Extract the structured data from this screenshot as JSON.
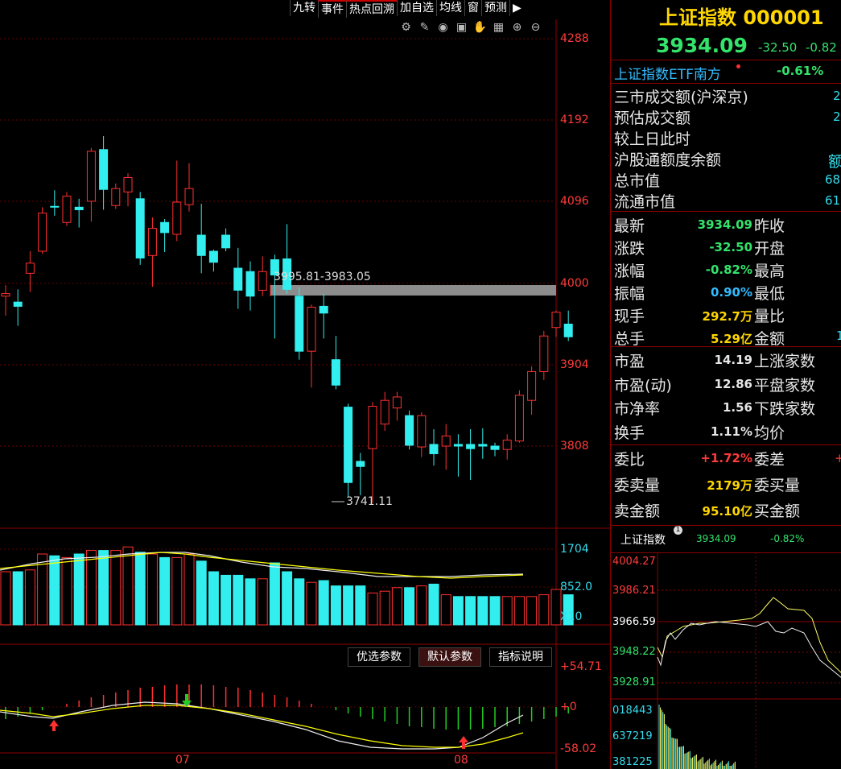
{
  "toolbar": {
    "items": [
      "九转",
      "事件",
      "热点回溯",
      "加自选",
      "均线",
      "窗",
      "预测"
    ]
  },
  "chart": {
    "price_axis": [
      "4288",
      "4192",
      "4096",
      "4000",
      "3904",
      "3808"
    ],
    "range_label": "3995.81-3983.05",
    "low_label": "3741.11",
    "vol_axis": [
      "1704",
      "852.0",
      "X10"
    ],
    "ind_axis": [
      "+54.71",
      "+0",
      "-58.02"
    ],
    "months": [
      "07",
      "08"
    ],
    "indicator_tabs": [
      "优选参数",
      "默认参数",
      "指标说明"
    ]
  },
  "panel": {
    "title": "上证指数 000001",
    "price": "3934.09",
    "change": "-32.50",
    "change_pct": "-0.82",
    "etf": {
      "name": "上证指数ETF南方",
      "pct": "-0.61%"
    },
    "info": [
      {
        "label": "三市成交额(沪深京)",
        "value": "2"
      },
      {
        "label": "预估成交额",
        "value": "2"
      },
      {
        "label": "较上日此时",
        "value": ""
      },
      {
        "label": "沪股通额度余额",
        "value": "额"
      },
      {
        "label": "总市值",
        "value": "68"
      },
      {
        "label": "流通市值",
        "value": "61"
      }
    ],
    "quote": [
      {
        "l": "最新",
        "v": "3934.09",
        "c": "#33e36b",
        "r": "昨收"
      },
      {
        "l": "涨跌",
        "v": "-32.50",
        "c": "#33e36b",
        "r": "开盘"
      },
      {
        "l": "涨幅",
        "v": "-0.82%",
        "c": "#33e36b",
        "r": "最高"
      },
      {
        "l": "振幅",
        "v": "0.90%",
        "c": "#33bbff",
        "r": "最低"
      },
      {
        "l": "现手",
        "v": "292.7万",
        "c": "#ffd700",
        "r": "量比"
      },
      {
        "l": "总手",
        "v": "5.29亿",
        "c": "#ffd700",
        "r": "金额"
      }
    ],
    "quote_extra": "1",
    "valuation": [
      {
        "l": "市盈",
        "v": "14.19",
        "r": "上涨家数"
      },
      {
        "l": "市盈(动)",
        "v": "12.86",
        "r": "平盘家数"
      },
      {
        "l": "市净率",
        "v": "1.56",
        "r": "下跌家数"
      },
      {
        "l": "换手",
        "v": "1.11%",
        "r": "均价"
      }
    ],
    "order": [
      {
        "l": "委比",
        "v": "+1.72%",
        "c": "#ff3b3b",
        "r": "委差",
        "x": "+"
      },
      {
        "l": "委卖量",
        "v": "2179万",
        "c": "#ffd700",
        "r": "委买量",
        "x": ""
      },
      {
        "l": "卖金额",
        "v": "95.10亿",
        "c": "#ffd700",
        "r": "买金额",
        "x": ""
      }
    ],
    "mini": {
      "name": "上证指数",
      "price": "3934.09",
      "pct": "-0.82%",
      "axis": [
        "4004.27",
        "3986.21",
        "3966.59",
        "3948.22",
        "3928.91",
        "018443",
        "637219",
        "381225"
      ]
    }
  },
  "chart_data": {
    "type": "candlestick",
    "candles": [
      {
        "o": 3985,
        "c": 3988,
        "h": 3998,
        "l": 3962
      },
      {
        "o": 3978,
        "c": 3973,
        "h": 3993,
        "l": 3950
      },
      {
        "o": 4012,
        "c": 4024,
        "h": 4038,
        "l": 3990
      },
      {
        "o": 4038,
        "c": 4083,
        "h": 4090,
        "l": 4035
      },
      {
        "o": 4091,
        "c": 4090,
        "h": 4110,
        "l": 4080
      },
      {
        "o": 4072,
        "c": 4103,
        "h": 4108,
        "l": 4068
      },
      {
        "o": 4090,
        "c": 4087,
        "h": 4100,
        "l": 4066
      },
      {
        "o": 4097,
        "c": 4156,
        "h": 4160,
        "l": 4073
      },
      {
        "o": 4158,
        "c": 4111,
        "h": 4174,
        "l": 4087
      },
      {
        "o": 4092,
        "c": 4112,
        "h": 4118,
        "l": 4088
      },
      {
        "o": 4108,
        "c": 4125,
        "h": 4130,
        "l": 4091
      },
      {
        "o": 4100,
        "c": 4030,
        "h": 4108,
        "l": 4022
      },
      {
        "o": 4033,
        "c": 4065,
        "h": 4078,
        "l": 3996
      },
      {
        "o": 4072,
        "c": 4060,
        "h": 4076,
        "l": 4037
      },
      {
        "o": 4058,
        "c": 4096,
        "h": 4145,
        "l": 4050
      },
      {
        "o": 4093,
        "c": 4112,
        "h": 4142,
        "l": 4085
      },
      {
        "o": 4057,
        "c": 4033,
        "h": 4094,
        "l": 4012
      },
      {
        "o": 4038,
        "c": 4025,
        "h": 4040,
        "l": 4014
      },
      {
        "o": 4057,
        "c": 4042,
        "h": 4065,
        "l": 4038
      },
      {
        "o": 4018,
        "c": 3992,
        "h": 4042,
        "l": 3970
      },
      {
        "o": 4014,
        "c": 3985,
        "h": 4026,
        "l": 3968
      },
      {
        "o": 3992,
        "c": 4014,
        "h": 4032,
        "l": 3985
      },
      {
        "o": 4028,
        "c": 4010,
        "h": 4034,
        "l": 3935
      },
      {
        "o": 4029,
        "c": 3993,
        "h": 4070,
        "l": 3988
      },
      {
        "o": 3985,
        "c": 3920,
        "h": 3995,
        "l": 3910
      },
      {
        "o": 3920,
        "c": 3972,
        "h": 3975,
        "l": 3877
      },
      {
        "o": 3973,
        "c": 3965,
        "h": 3988,
        "l": 3935
      },
      {
        "o": 3910,
        "c": 3880,
        "h": 3938,
        "l": 3875
      },
      {
        "o": 3854,
        "c": 3765,
        "h": 3858,
        "l": 3748
      },
      {
        "o": 3790,
        "c": 3784,
        "h": 3800,
        "l": 3750
      },
      {
        "o": 3805,
        "c": 3855,
        "h": 3860,
        "l": 3741
      },
      {
        "o": 3834,
        "c": 3862,
        "h": 3872,
        "l": 3826
      },
      {
        "o": 3853,
        "c": 3866,
        "h": 3872,
        "l": 3838
      },
      {
        "o": 3844,
        "c": 3809,
        "h": 3850,
        "l": 3804
      },
      {
        "o": 3807,
        "c": 3844,
        "h": 3848,
        "l": 3795
      },
      {
        "o": 3810,
        "c": 3799,
        "h": 3828,
        "l": 3785
      },
      {
        "o": 3808,
        "c": 3820,
        "h": 3834,
        "l": 3780
      },
      {
        "o": 3810,
        "c": 3808,
        "h": 3822,
        "l": 3772
      },
      {
        "o": 3810,
        "c": 3805,
        "h": 3828,
        "l": 3768
      },
      {
        "o": 3810,
        "c": 3808,
        "h": 3829,
        "l": 3793
      },
      {
        "o": 3808,
        "c": 3804,
        "h": 3812,
        "l": 3796
      },
      {
        "o": 3804,
        "c": 3815,
        "h": 3822,
        "l": 3792
      },
      {
        "o": 3814,
        "c": 3868,
        "h": 3874,
        "l": 3812
      },
      {
        "o": 3862,
        "c": 3896,
        "h": 3902,
        "l": 3845
      },
      {
        "o": 3896,
        "c": 3938,
        "h": 3944,
        "l": 3886
      },
      {
        "o": 3948,
        "c": 3966,
        "h": 3968,
        "l": 3937
      },
      {
        "o": 3952,
        "c": 3937,
        "h": 3968,
        "l": 3932
      }
    ],
    "volume": [
      30,
      30,
      31,
      40,
      39,
      38,
      40,
      42,
      42,
      42,
      44,
      41,
      40,
      38,
      38,
      40,
      36,
      30,
      28,
      28,
      26,
      26,
      35,
      30,
      26,
      24,
      25,
      22,
      22,
      22,
      18,
      19,
      21,
      21,
      22,
      23,
      17,
      16,
      16,
      16,
      16,
      16,
      16,
      16,
      17,
      20,
      17
    ],
    "ylim": [
      3760,
      4320
    ]
  }
}
